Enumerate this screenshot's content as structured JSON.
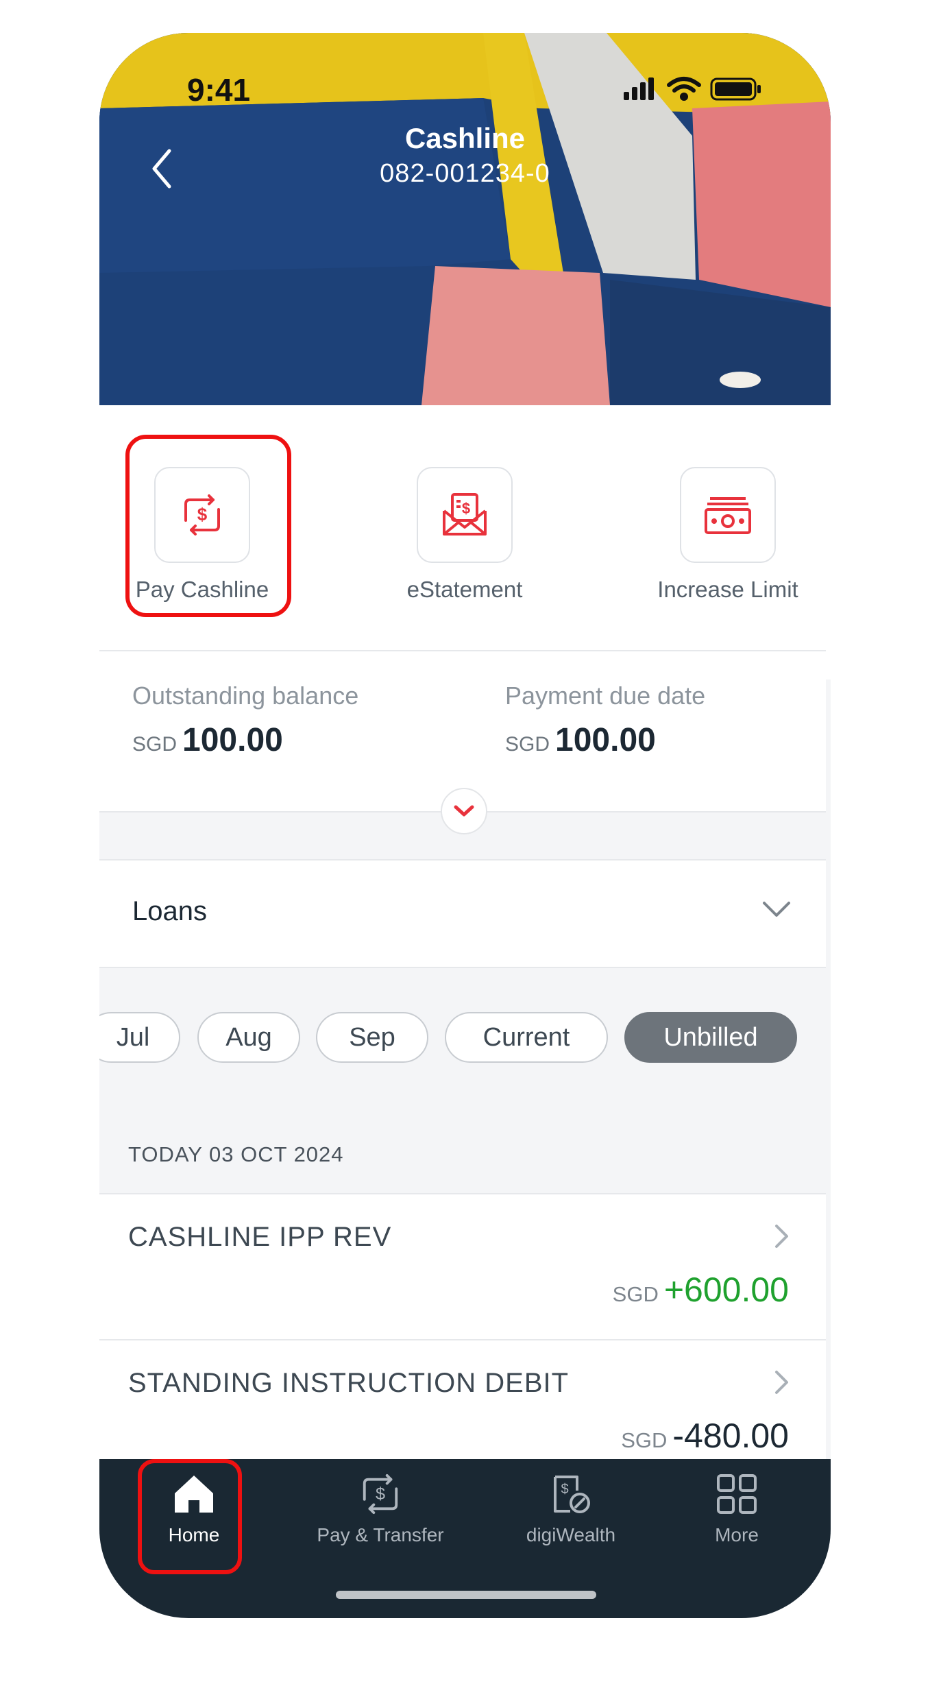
{
  "status_bar": {
    "time": "9:41"
  },
  "header": {
    "title": "Cashline",
    "account_number": "082-001234-0"
  },
  "quick_actions": [
    {
      "label": "Pay Cashline",
      "icon": "pay-transfer-icon"
    },
    {
      "label": "eStatement",
      "icon": "estatement-envelope-icon"
    },
    {
      "label": "Increase Limit",
      "icon": "cash-note-icon"
    }
  ],
  "balance": {
    "outstanding_label": "Outstanding balance",
    "outstanding_currency": "SGD",
    "outstanding_value": "100.00",
    "due_label": "Payment due date",
    "due_currency": "SGD",
    "due_value": "100.00"
  },
  "loans": {
    "title": "Loans"
  },
  "months": [
    {
      "label": "Jul",
      "active": false
    },
    {
      "label": "Aug",
      "active": false
    },
    {
      "label": "Sep",
      "active": false
    },
    {
      "label": "Current",
      "active": false
    },
    {
      "label": "Unbilled",
      "active": true
    }
  ],
  "transactions": {
    "date_header": "TODAY 03 OCT 2024",
    "items": [
      {
        "name": "CASHLINE IPP REV",
        "currency": "SGD",
        "amount": "+600.00",
        "color": "#1fa12e"
      },
      {
        "name": "STANDING INSTRUCTION DEBIT",
        "currency": "SGD",
        "amount": "-480.00",
        "color": "#1c2833"
      }
    ]
  },
  "tabbar": [
    {
      "label": "Home",
      "icon": "home-icon",
      "active": true
    },
    {
      "label": "Pay & Transfer",
      "icon": "pay-transfer-icon",
      "active": false
    },
    {
      "label": "digiWealth",
      "icon": "digiwealth-icon",
      "active": false
    },
    {
      "label": "More",
      "icon": "grid-icon",
      "active": false
    }
  ],
  "colors": {
    "accent_red": "#e8323c",
    "highlight_red": "#ee1111",
    "positive_green": "#1fa12e",
    "tabbar_bg": "#1a2833"
  }
}
